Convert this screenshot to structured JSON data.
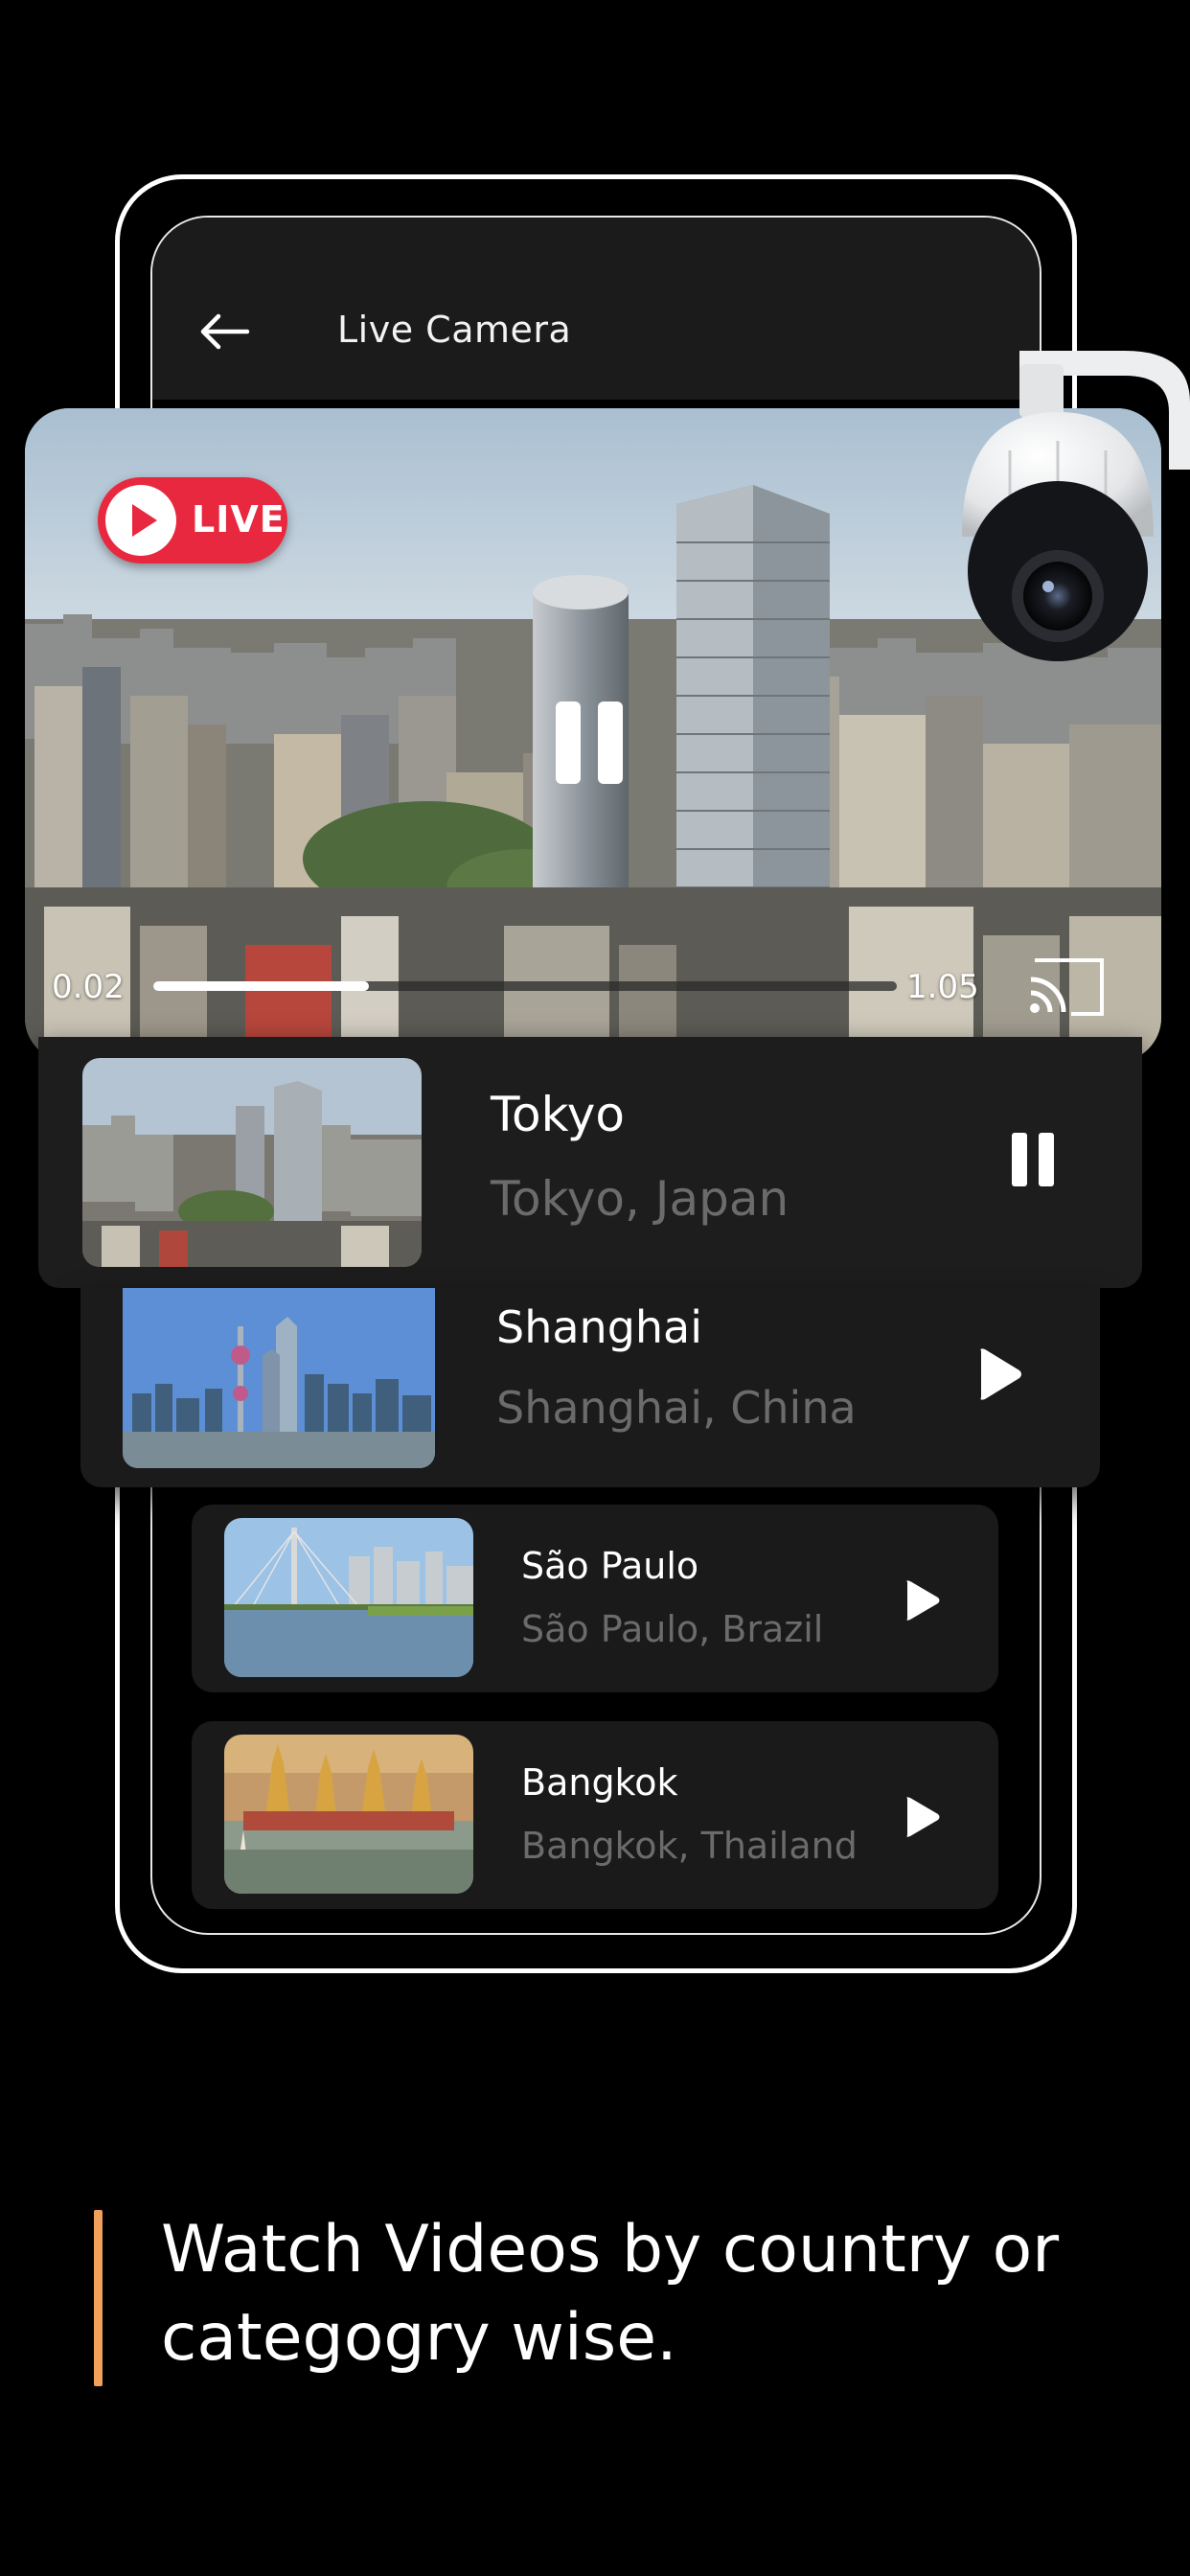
{
  "app_bar": {
    "title": "Live Camera",
    "back_icon": "arrow-left-icon"
  },
  "player": {
    "live_label": "LIVE",
    "current_time": "0.02",
    "end_time": "1.05",
    "progress": 0.29,
    "live_color": "#e8283f"
  },
  "cameras": [
    {
      "name": "Tokyo",
      "location": "Tokyo, Japan",
      "state": "playing",
      "icon": "pause-icon"
    },
    {
      "name": "Shanghai",
      "location": "Shanghai, China",
      "state": "paused",
      "icon": "play-icon"
    },
    {
      "name": "São Paulo",
      "location": "São Paulo, Brazil",
      "state": "paused",
      "icon": "play-icon"
    },
    {
      "name": "Bangkok",
      "location": "Bangkok, Thailand",
      "state": "paused",
      "icon": "play-icon"
    }
  ],
  "tagline": {
    "text": "Watch Videos by country or categogry wise.",
    "accent_color": "#f1a05b"
  }
}
